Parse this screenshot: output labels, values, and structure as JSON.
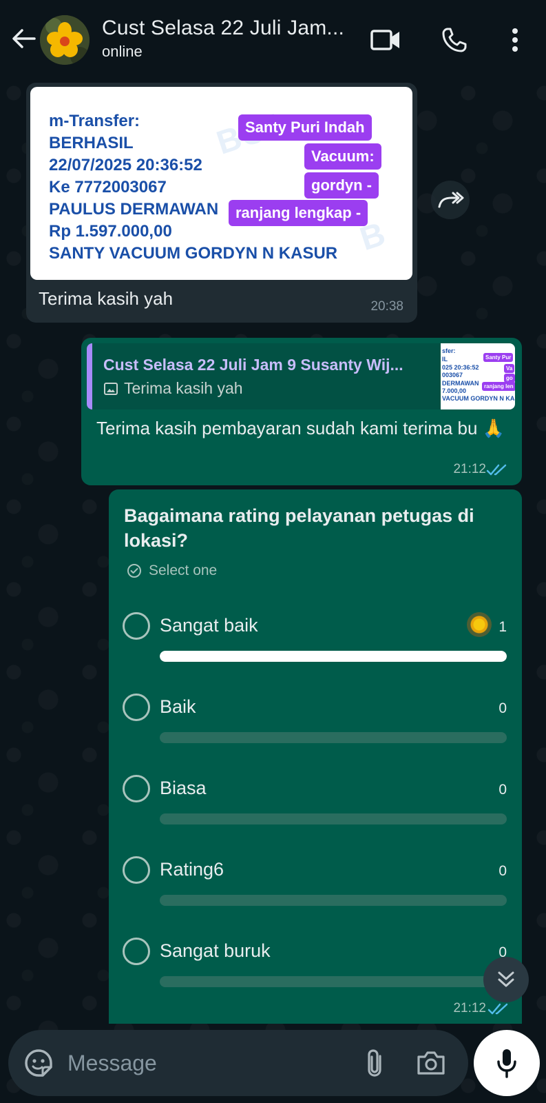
{
  "header": {
    "back_icon": "arrow-left-icon",
    "title": "Cust Selasa 22 Juli Jam...",
    "status": "online",
    "video_icon": "video-call-icon",
    "call_icon": "phone-icon",
    "menu_icon": "more-vert-icon"
  },
  "incoming": {
    "receipt": {
      "lines": [
        "m-Transfer:",
        "BERHASIL",
        "22/07/2025 20:36:52",
        "Ke 7772003067",
        "PAULUS DERMAWAN",
        "Rp 1.597.000,00",
        "SANTY VACUUM GORDYN N KASUR"
      ],
      "tags": [
        "Santy Puri Indah",
        "Vacuum:",
        "gordyn -",
        "ranjang lengkap -"
      ]
    },
    "caption": "Terima kasih yah",
    "time": "20:38"
  },
  "outgoing": {
    "quote_name": "Cust Selasa 22 Juli Jam 9 Susanty Wij...",
    "quote_text": "Terima kasih yah",
    "quote_thumb_lines": [
      "sfer:",
      "IL",
      "025 20:36:52",
      "003067",
      "DERMAWAN",
      "7.000,00",
      "VACUUM GORDYN N KASU"
    ],
    "quote_thumb_tags": [
      "Santy Pur",
      "Va",
      "go",
      "ranjang len"
    ],
    "text": "Terima kasih pembayaran sudah kami terima bu 🙏",
    "time": "21:12"
  },
  "poll": {
    "question": "Bagaimana rating pelayanan petugas di lokasi?",
    "hint": "Select one",
    "options": [
      {
        "label": "Sangat baik",
        "count": "1",
        "fill": 1.0
      },
      {
        "label": "Baik",
        "count": "0",
        "fill": 0
      },
      {
        "label": "Biasa",
        "count": "0",
        "fill": 0
      },
      {
        "label": "Rating6",
        "count": "0",
        "fill": 0
      },
      {
        "label": "Sangat buruk",
        "count": "0",
        "fill": 0
      }
    ],
    "time": "21:12"
  },
  "composer": {
    "placeholder": "Message",
    "emoji_icon": "sticker-icon",
    "attach_icon": "paperclip-icon",
    "camera_icon": "camera-icon",
    "mic_icon": "mic-icon"
  },
  "colors": {
    "background": "#0b141a",
    "incoming_bubble": "#202c33",
    "outgoing_bubble": "#005c4b",
    "read_ticks": "#53bdeb"
  }
}
